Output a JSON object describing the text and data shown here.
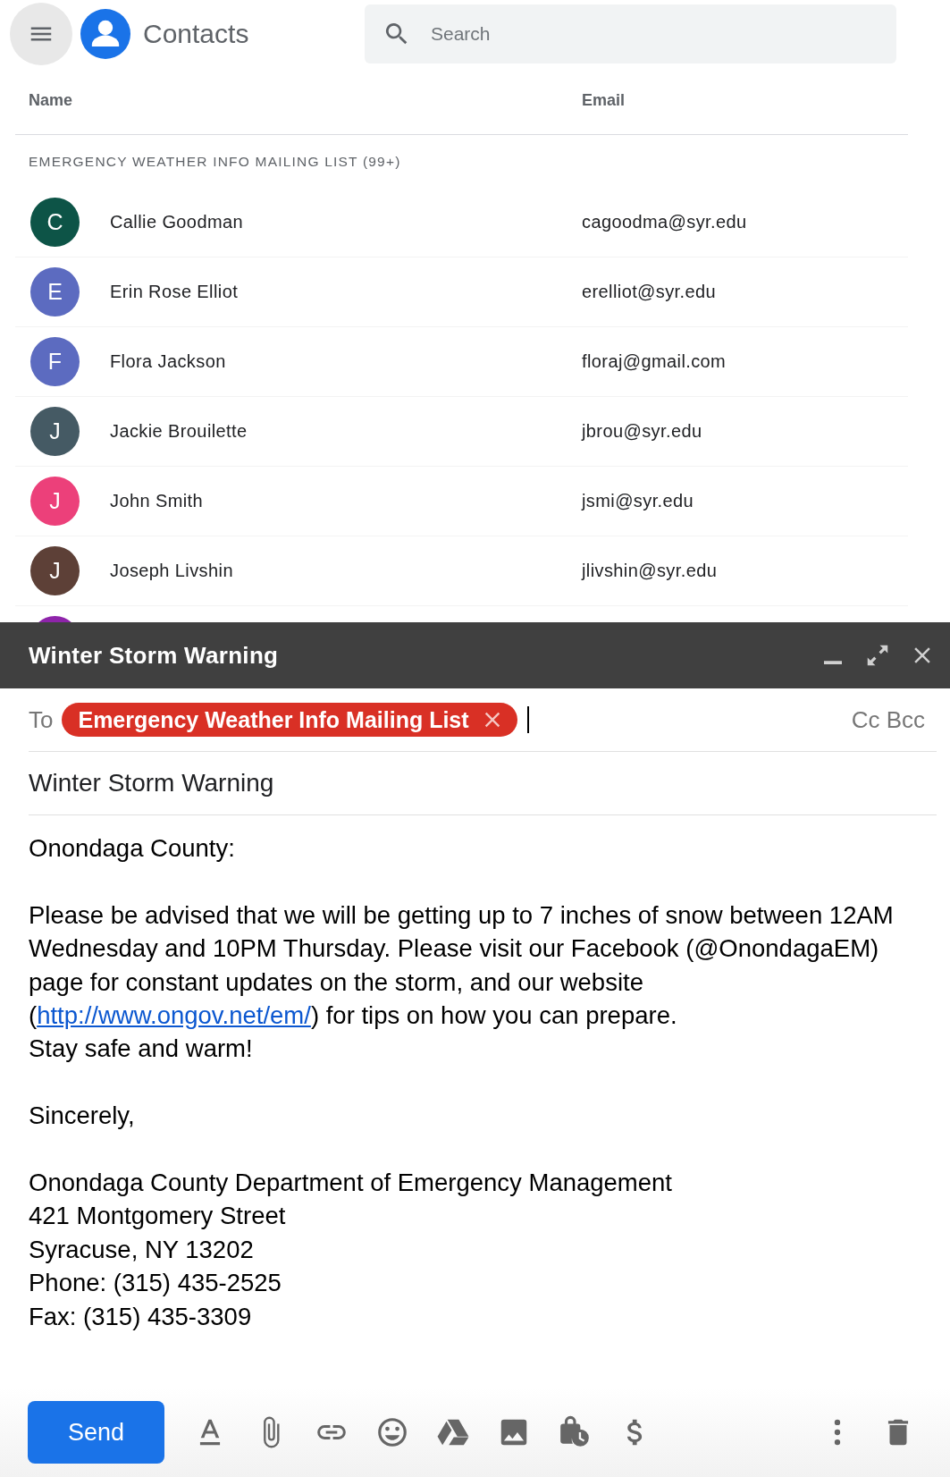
{
  "app": {
    "title": "Contacts"
  },
  "search": {
    "placeholder": "Search"
  },
  "table": {
    "columns": [
      "Name",
      "Email"
    ],
    "section": "EMERGENCY WEATHER INFO MAILING LIST (99+)",
    "rows": [
      {
        "initial": "C",
        "color": "#0d5447",
        "name": "Callie Goodman",
        "email": "cagoodma@syr.edu"
      },
      {
        "initial": "E",
        "color": "#5c6bc0",
        "name": "Erin Rose Elliot",
        "email": "erelliot@syr.edu"
      },
      {
        "initial": "F",
        "color": "#5c6bc0",
        "name": "Flora Jackson",
        "email": "floraj@gmail.com"
      },
      {
        "initial": "J",
        "color": "#455a64",
        "name": "Jackie Brouilette",
        "email": "jbrou@syr.edu"
      },
      {
        "initial": "J",
        "color": "#ec407a",
        "name": "John Smith",
        "email": "jsmi@syr.edu"
      },
      {
        "initial": "J",
        "color": "#5d4037",
        "name": "Joseph Livshin",
        "email": "jlivshin@syr.edu"
      },
      {
        "color": "#8e24aa"
      }
    ]
  },
  "compose": {
    "title": "Winter Storm Warning",
    "to_label": "To",
    "recipients": [
      {
        "label": "Emergency Weather Info Mailing List",
        "color": "#d93025"
      }
    ],
    "cc_bcc": "Cc Bcc",
    "subject": "Winter Storm Warning",
    "body": [
      {
        "lines": [
          [
            {
              "kind": "text",
              "text": "Onondaga County:"
            }
          ]
        ]
      },
      {
        "lines": [
          [
            {
              "kind": "text",
              "text": "Please be advised that we will be getting up to 7 inches of snow between 12AM Wednesday and 10PM Thursday. Please visit our Facebook (@OnondagaEM) page for constant updates on the storm, and our website ("
            },
            {
              "kind": "link",
              "text": "http://www.ongov.net/em/"
            },
            {
              "kind": "text",
              "text": ") for tips on how you can prepare."
            }
          ],
          [
            {
              "kind": "text",
              "text": "Stay safe and warm!"
            }
          ]
        ]
      },
      {
        "lines": [
          [
            {
              "kind": "text",
              "text": "Sincerely,"
            }
          ]
        ]
      },
      {
        "lines": [
          [
            {
              "kind": "text",
              "text": "Onondaga County Department of Emergency Management"
            }
          ],
          [
            {
              "kind": "text",
              "text": "421 Montgomery Street"
            }
          ],
          [
            {
              "kind": "text",
              "text": "Syracuse, NY 13202"
            }
          ],
          [
            {
              "kind": "text",
              "text": "Phone: (315) 435-2525"
            }
          ],
          [
            {
              "kind": "text",
              "text": "Fax: (315) 435-3309"
            }
          ]
        ]
      }
    ],
    "send": "Send"
  }
}
